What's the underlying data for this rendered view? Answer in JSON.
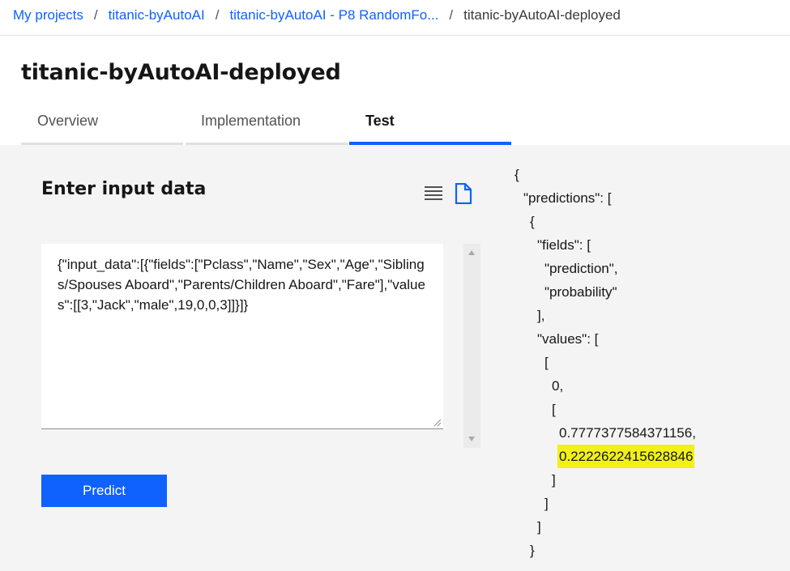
{
  "breadcrumb": {
    "items": [
      "My projects",
      "titanic-byAutoAI",
      "titanic-byAutoAI - P8 RandomFo..."
    ],
    "current": "titanic-byAutoAI-deployed",
    "separator": "/"
  },
  "page": {
    "title": "titanic-byAutoAI-deployed"
  },
  "tabs": [
    {
      "label": "Overview",
      "active": false
    },
    {
      "label": "Implementation",
      "active": false
    },
    {
      "label": "Test",
      "active": true
    }
  ],
  "input_panel": {
    "title": "Enter input data",
    "icons": [
      "list-view-icon",
      "file-icon"
    ],
    "input_value": "{\"input_data\":[{\"fields\":[\"Pclass\",\"Name\",\"Sex\",\"Age\",\"Siblings/Spouses Aboard\",\"Parents/Children Aboard\",\"Fare\"],\"values\":[[3,\"Jack\",\"male\",19,0,0,3]]}]}",
    "predict_label": "Predict"
  },
  "output_panel": {
    "lines": [
      "{",
      "\"predictions\": [",
      "{",
      "\"fields\": [",
      "\"prediction\",",
      "\"probability\"",
      "],",
      "\"values\": [",
      "[",
      "0,",
      "[",
      "0.7777377584371156,",
      "0.2222622415628846",
      "]",
      "]",
      "]",
      "}"
    ],
    "highlighted_value": "0.2222622415628846",
    "highlight_color": "#f1f118"
  },
  "colors": {
    "accent": "#0f62fe",
    "panel_bg": "#f4f4f4"
  }
}
